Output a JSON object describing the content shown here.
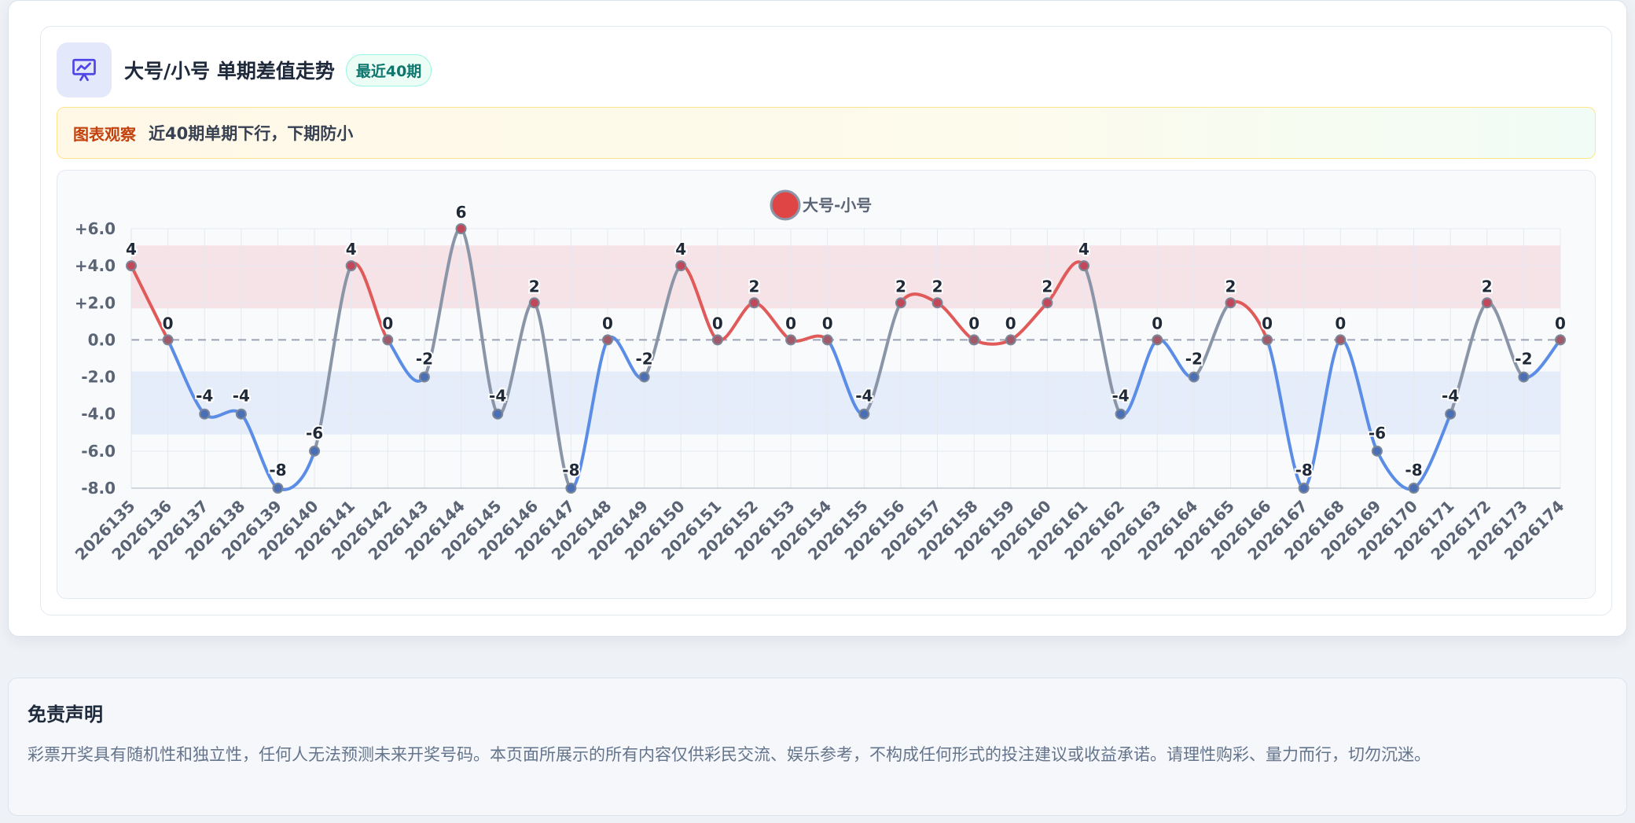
{
  "header": {
    "title": "大号/小号 单期差值走势",
    "badge": "最近40期",
    "icon": "presentation-chart-icon"
  },
  "insight": {
    "label": "图表观察",
    "text": "近40期单期下行，下期防小"
  },
  "chart_data": {
    "type": "line",
    "categories": [
      "2026135",
      "2026136",
      "2026137",
      "2026138",
      "2026139",
      "2026140",
      "2026141",
      "2026142",
      "2026143",
      "2026144",
      "2026145",
      "2026146",
      "2026147",
      "2026148",
      "2026149",
      "2026150",
      "2026151",
      "2026152",
      "2026153",
      "2026154",
      "2026155",
      "2026156",
      "2026157",
      "2026158",
      "2026159",
      "2026160",
      "2026161",
      "2026162",
      "2026163",
      "2026164",
      "2026165",
      "2026166",
      "2026167",
      "2026168",
      "2026169",
      "2026170",
      "2026171",
      "2026172",
      "2026173",
      "2026174"
    ],
    "series": [
      {
        "name": "大号-小号",
        "values": [
          4,
          0,
          -4,
          -4,
          -8,
          -6,
          4,
          0,
          -2,
          6,
          -4,
          2,
          -8,
          0,
          -2,
          4,
          0,
          2,
          0,
          0,
          -4,
          2,
          2,
          0,
          0,
          2,
          4,
          -4,
          0,
          -2,
          2,
          0,
          -8,
          0,
          -6,
          -8,
          -4,
          2,
          -2,
          0
        ]
      }
    ],
    "ylim": [
      -8,
      6
    ],
    "yticks": [
      "+6.0",
      "+4.0",
      "+2.0",
      "0.0",
      "-2.0",
      "-4.0",
      "-6.0",
      "-8.0"
    ],
    "upper_band": [
      1.7,
      5.1
    ],
    "lower_band": [
      -5.1,
      -1.7
    ],
    "legend_position": "top-center",
    "grid": true,
    "colors": {
      "up": "#e05a5a",
      "down": "#5b8de6",
      "flat": "#8a96a8",
      "upper_band": "#f6e3e7",
      "lower_band": "#e6edfa",
      "legend_dot": "#e04545"
    }
  },
  "disclaimer": {
    "title": "免责声明",
    "text": "彩票开奖具有随机性和独立性，任何人无法预测未来开奖号码。本页面所展示的所有内容仅供彩民交流、娱乐参考，不构成任何形式的投注建议或收益承诺。请理性购彩、量力而行，切勿沉迷。"
  }
}
